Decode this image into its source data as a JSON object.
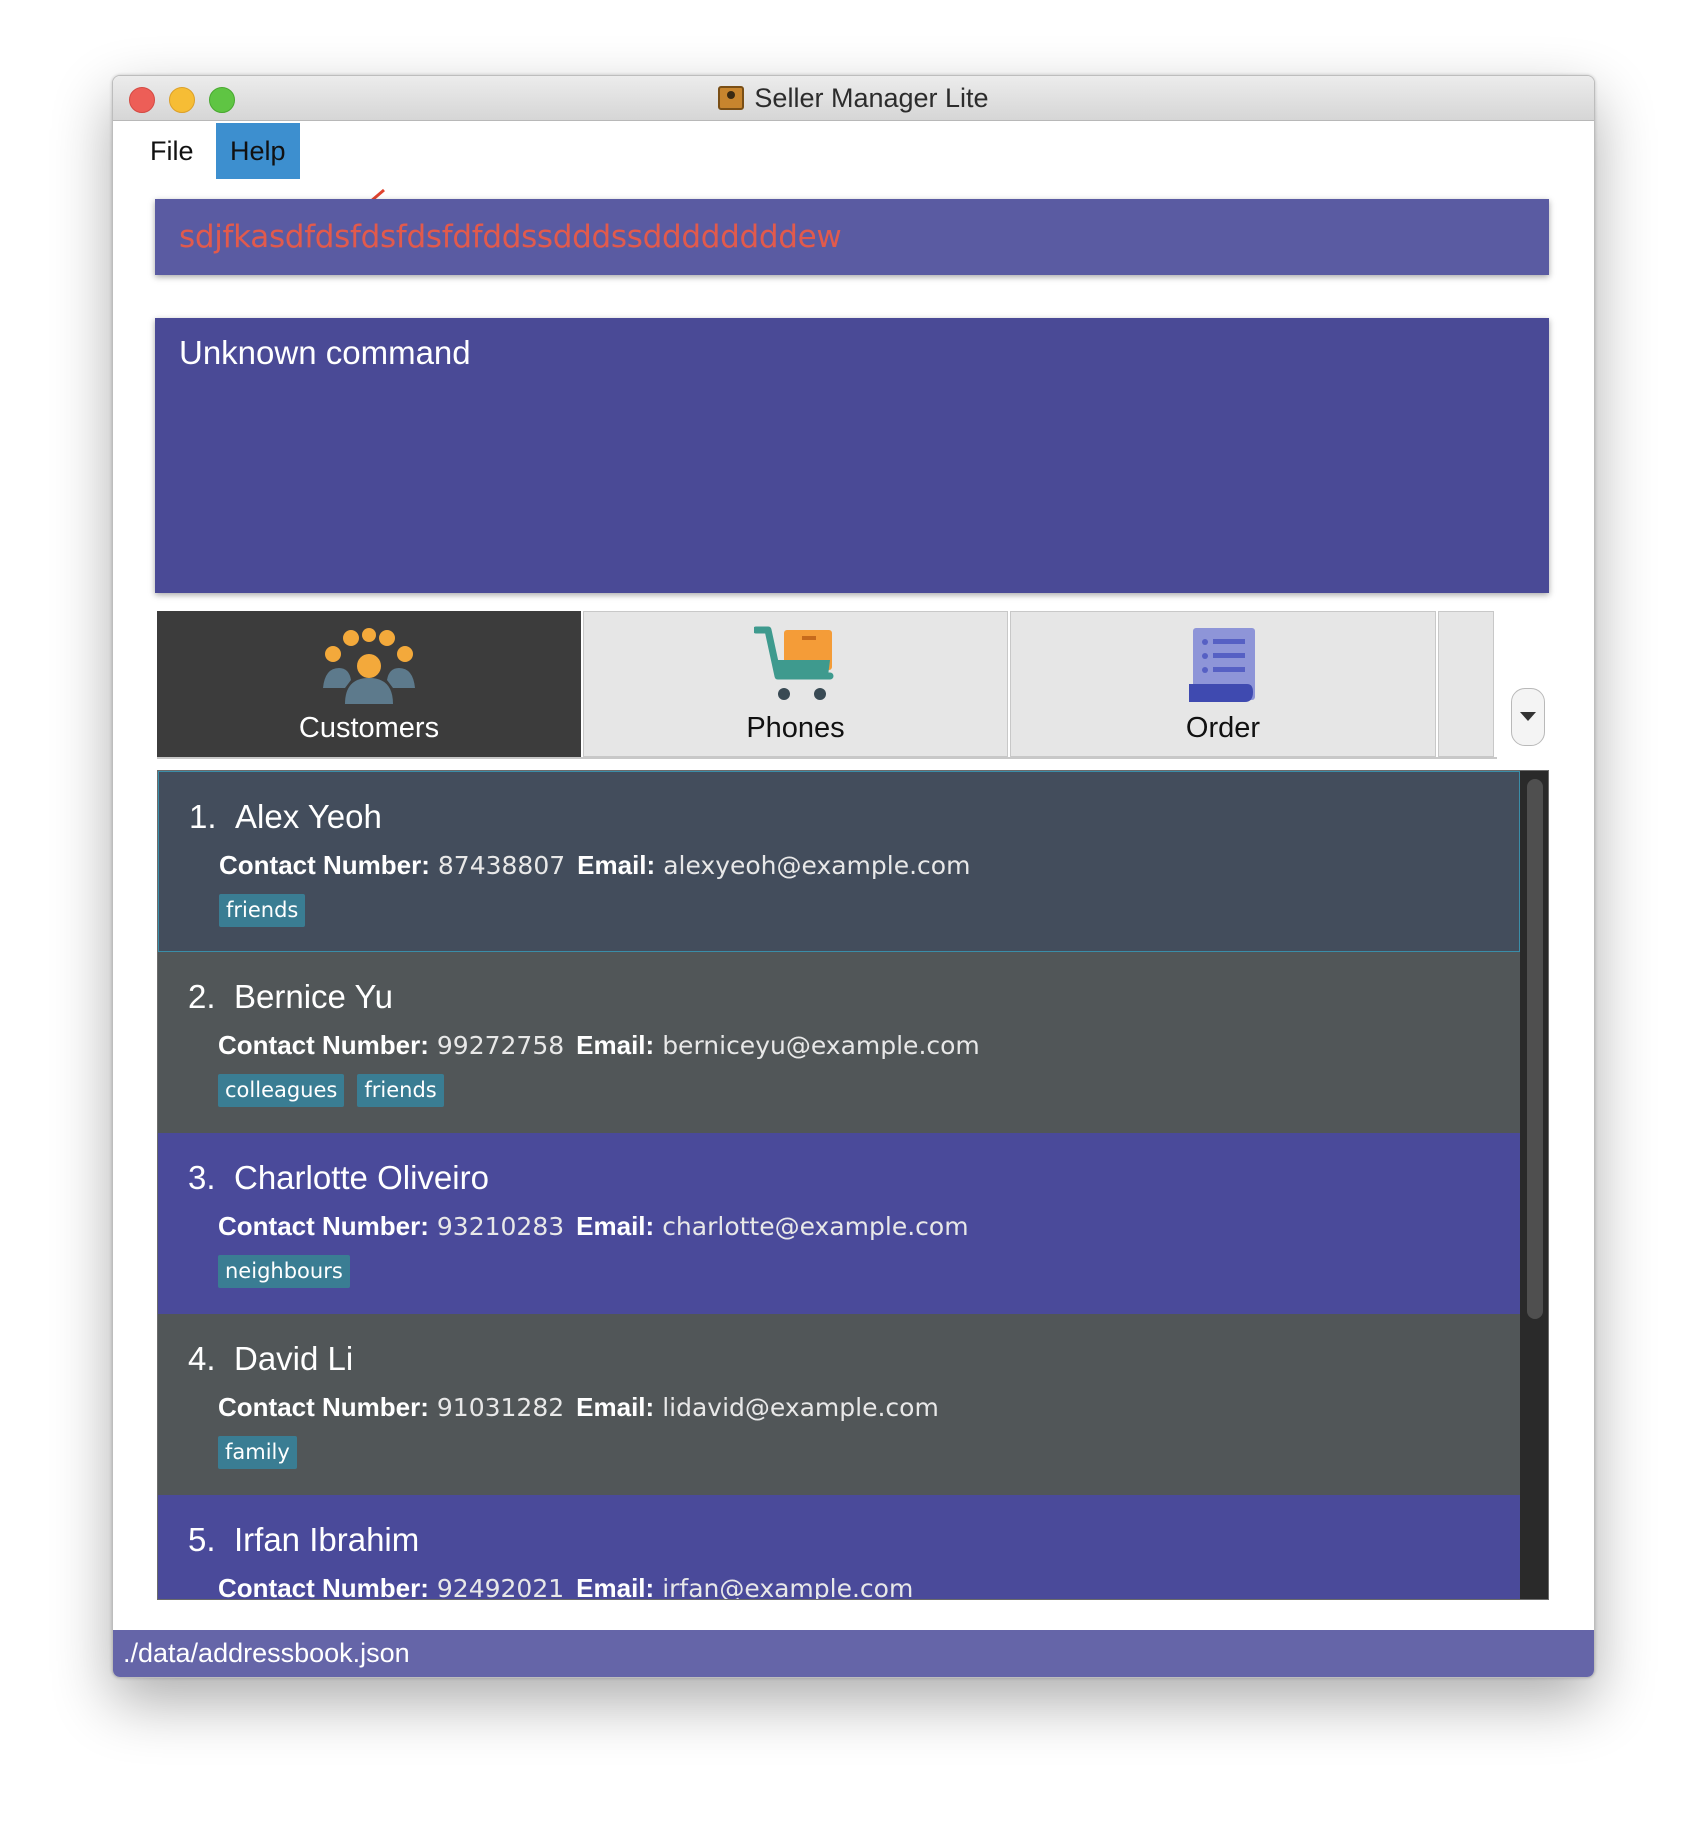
{
  "window": {
    "title": "Seller Manager Lite",
    "title_icon": "address-book-icon"
  },
  "menu": {
    "file_label": "File",
    "help_label": "Help"
  },
  "annotation": {
    "arrow_color": "#e0432f"
  },
  "command_box": {
    "value": "sdjfkasdfdsfdsfdsfdfddssdddssddddddddew"
  },
  "result_display": {
    "text": "Unknown command"
  },
  "tabs": [
    {
      "label": "Customers",
      "icon": "customers-icon",
      "active": true
    },
    {
      "label": "Phones",
      "icon": "shopping-cart-icon",
      "active": false
    },
    {
      "label": "Order",
      "icon": "order-list-icon",
      "active": false
    }
  ],
  "customers": [
    {
      "index": "1.",
      "name": "Alex Yeoh",
      "contact_label": "Contact Number:",
      "contact": "87438807",
      "email_label": "Email:",
      "email": "alexyeoh@example.com",
      "tags": [
        "friends"
      ]
    },
    {
      "index": "2.",
      "name": "Bernice Yu",
      "contact_label": "Contact Number:",
      "contact": "99272758",
      "email_label": "Email:",
      "email": "berniceyu@example.com",
      "tags": [
        "colleagues",
        "friends"
      ]
    },
    {
      "index": "3.",
      "name": "Charlotte Oliveiro",
      "contact_label": "Contact Number:",
      "contact": "93210283",
      "email_label": "Email:",
      "email": "charlotte@example.com",
      "tags": [
        "neighbours"
      ]
    },
    {
      "index": "4.",
      "name": "David Li",
      "contact_label": "Contact Number:",
      "contact": "91031282",
      "email_label": "Email:",
      "email": "lidavid@example.com",
      "tags": [
        "family"
      ]
    },
    {
      "index": "5.",
      "name": "Irfan Ibrahim",
      "contact_label": "Contact Number:",
      "contact": "92492021",
      "email_label": "Email:",
      "email": "irfan@example.com",
      "tags": []
    }
  ],
  "status_bar": {
    "path": "./data/addressbook.json"
  },
  "colors": {
    "command_bg": "#5a5ba2",
    "command_text": "#e25a4c",
    "result_bg": "#4a4a96",
    "card_gray": "#515658",
    "card_blue": "#4a4a9a",
    "tag_bg": "#3a7d93",
    "status_bg": "#6565a8",
    "menu_highlight": "#3d8fcf"
  }
}
